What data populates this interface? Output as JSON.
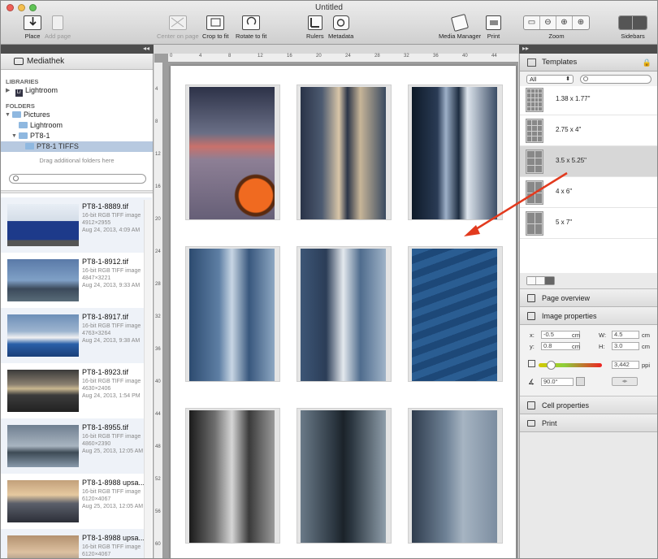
{
  "window": {
    "title": "Untitled"
  },
  "toolbar": {
    "place": "Place",
    "add_page": "Add page",
    "center_on_page": "Center on page",
    "crop_to_fit": "Crop to fit",
    "rotate_to_fit": "Rotate to fit",
    "rulers": "Rulers",
    "metadata": "Metadata",
    "media_manager": "Media Manager",
    "print": "Print",
    "zoom": "Zoom",
    "sidebars": "Sidebars"
  },
  "left_panel": {
    "title": "Mediathek",
    "libraries_heading": "LIBRARIES",
    "library_item": "Lightroom",
    "folders_heading": "FOLDERS",
    "folders": [
      "Pictures",
      "Lightroom",
      "PT8-1",
      "PT8-1 TIFFS"
    ],
    "drag_hint": "Drag additional folders here",
    "files": [
      {
        "name": "PT8-1-8889.tif",
        "type": "16-bit RGB TIFF image",
        "dims": "4912×2955",
        "date": "Aug 24, 2013, 4:09 AM"
      },
      {
        "name": "PT8-1-8912.tif",
        "type": "16-bit RGB TIFF image",
        "dims": "4847×3221",
        "date": "Aug 24, 2013, 9:33 AM"
      },
      {
        "name": "PT8-1-8917.tif",
        "type": "16-bit RGB TIFF image",
        "dims": "4763×3264",
        "date": "Aug 24, 2013, 9:38 AM"
      },
      {
        "name": "PT8-1-8923.tif",
        "type": "16-bit RGB TIFF image",
        "dims": "4630×2406",
        "date": "Aug 24, 2013, 1:54 PM"
      },
      {
        "name": "PT8-1-8955.tif",
        "type": "16-bit RGB TIFF image",
        "dims": "4860×2390",
        "date": "Aug 25, 2013, 12:05 AM"
      },
      {
        "name": "PT8-1-8988 upsa...",
        "type": "16-bit RGB TIFF image",
        "dims": "6120×4067",
        "date": "Aug 25, 2013, 12:05 AM"
      },
      {
        "name": "PT8-1-8988 upsa...",
        "type": "16-bit RGB TIFF image",
        "dims": "6120×4067",
        "date": ""
      }
    ]
  },
  "ruler": {
    "marks": [
      "0",
      "4",
      "8",
      "12",
      "16",
      "20",
      "24",
      "28",
      "32",
      "36",
      "40",
      "44"
    ],
    "vmarks": [
      "4",
      "8",
      "12",
      "16",
      "20",
      "24",
      "28",
      "32",
      "36",
      "40",
      "44",
      "48",
      "52",
      "56",
      "60"
    ]
  },
  "right_panel": {
    "templates_title": "Templates",
    "filter_value": "All",
    "templates": [
      "1.38 x 1.77\"",
      "2.75 x 4\"",
      "3.5 x 5.25\"",
      "4 x 6\"",
      "5 x 7\""
    ],
    "page_overview": "Page overview",
    "image_properties": "Image properties",
    "x_label": "x:",
    "x_value": "-0.5",
    "x_unit": "cm",
    "y_label": "y:",
    "y_value": "0.8",
    "y_unit": "cm",
    "w_label": "W:",
    "w_value": "4.5",
    "w_unit": "cm",
    "h_label": "H:",
    "h_value": "3.0",
    "h_unit": "cm",
    "ppi_value": "3,442",
    "ppi_unit": "ppi",
    "rotation_value": "90.0°",
    "cell_properties": "Cell properties",
    "print": "Print"
  }
}
